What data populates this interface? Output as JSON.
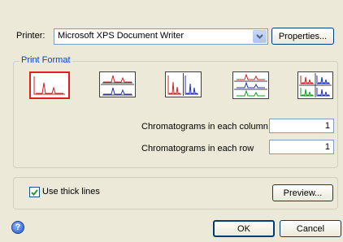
{
  "printer": {
    "label": "Printer:",
    "selected": "Microsoft XPS Document Writer",
    "properties_label": "Properties..."
  },
  "print_format": {
    "title": "Print Format",
    "formats": [
      {
        "icon": "single-chromatogram-icon",
        "selected": true
      },
      {
        "icon": "two-rows-chromatogram-icon",
        "selected": false
      },
      {
        "icon": "two-columns-chromatogram-icon",
        "selected": false
      },
      {
        "icon": "three-rows-chromatogram-icon",
        "selected": false
      },
      {
        "icon": "grid-2x2-chromatogram-icon",
        "selected": false
      }
    ],
    "column_label": "Chromatograms in each column",
    "column_value": "1",
    "row_label": "Chromatograms in each row",
    "row_value": "1"
  },
  "thick_lines": {
    "label": "Use thick lines",
    "checked": true,
    "preview_label": "Preview..."
  },
  "footer": {
    "help_glyph": "?",
    "ok_label": "OK",
    "cancel_label": "Cancel"
  },
  "colors": {
    "background": "#ece9d8",
    "group_title": "#0046d5",
    "selected_border": "#e21f1f",
    "trace_red": "#d02020",
    "trace_blue": "#2030c0",
    "trace_green": "#10a020"
  }
}
